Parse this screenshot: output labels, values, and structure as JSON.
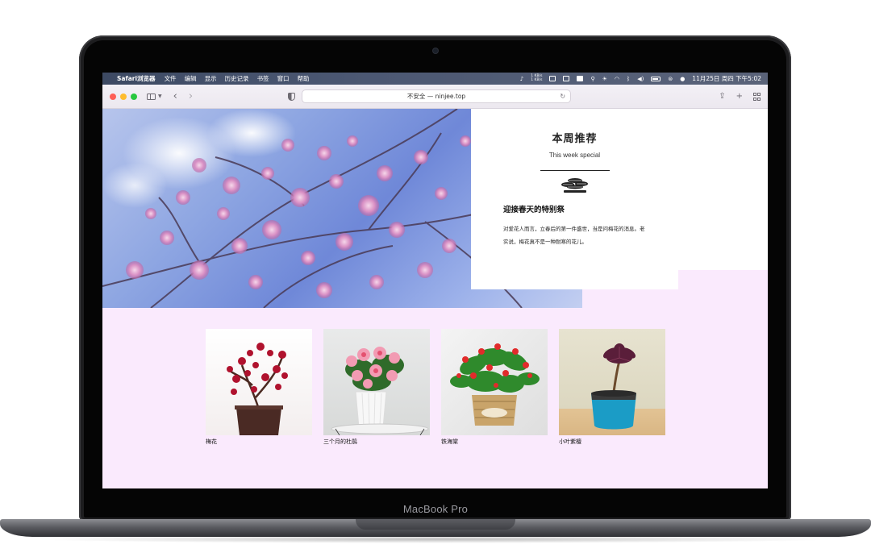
{
  "device": {
    "label": "MacBook Pro"
  },
  "menubar": {
    "app_name": "Safari浏览器",
    "items": [
      "文件",
      "编辑",
      "显示",
      "历史记录",
      "书签",
      "窗口",
      "帮助"
    ],
    "network_up": "1 KB/s",
    "network_down": "1 KB/s",
    "clock": "11月25日 周四 下午5:02"
  },
  "toolbar": {
    "address": "不安全 — ninjee.top"
  },
  "feature": {
    "title": "本周推荐",
    "subtitle": "This week special",
    "headline": "迎接春天的特别祭",
    "body": "对爱花人而言，立春后的第一件盛世，当是问梅花的消息。老实说，梅花真不是一种耐寒的花儿。"
  },
  "products": [
    {
      "name": "梅花"
    },
    {
      "name": "三个月的杜鹃"
    },
    {
      "name": "铁海棠"
    },
    {
      "name": "小叶紫檀"
    }
  ],
  "colors": {
    "page_bg": "#faeafd",
    "menubar": "#4c5873",
    "toolbar": "#ece8ef"
  }
}
